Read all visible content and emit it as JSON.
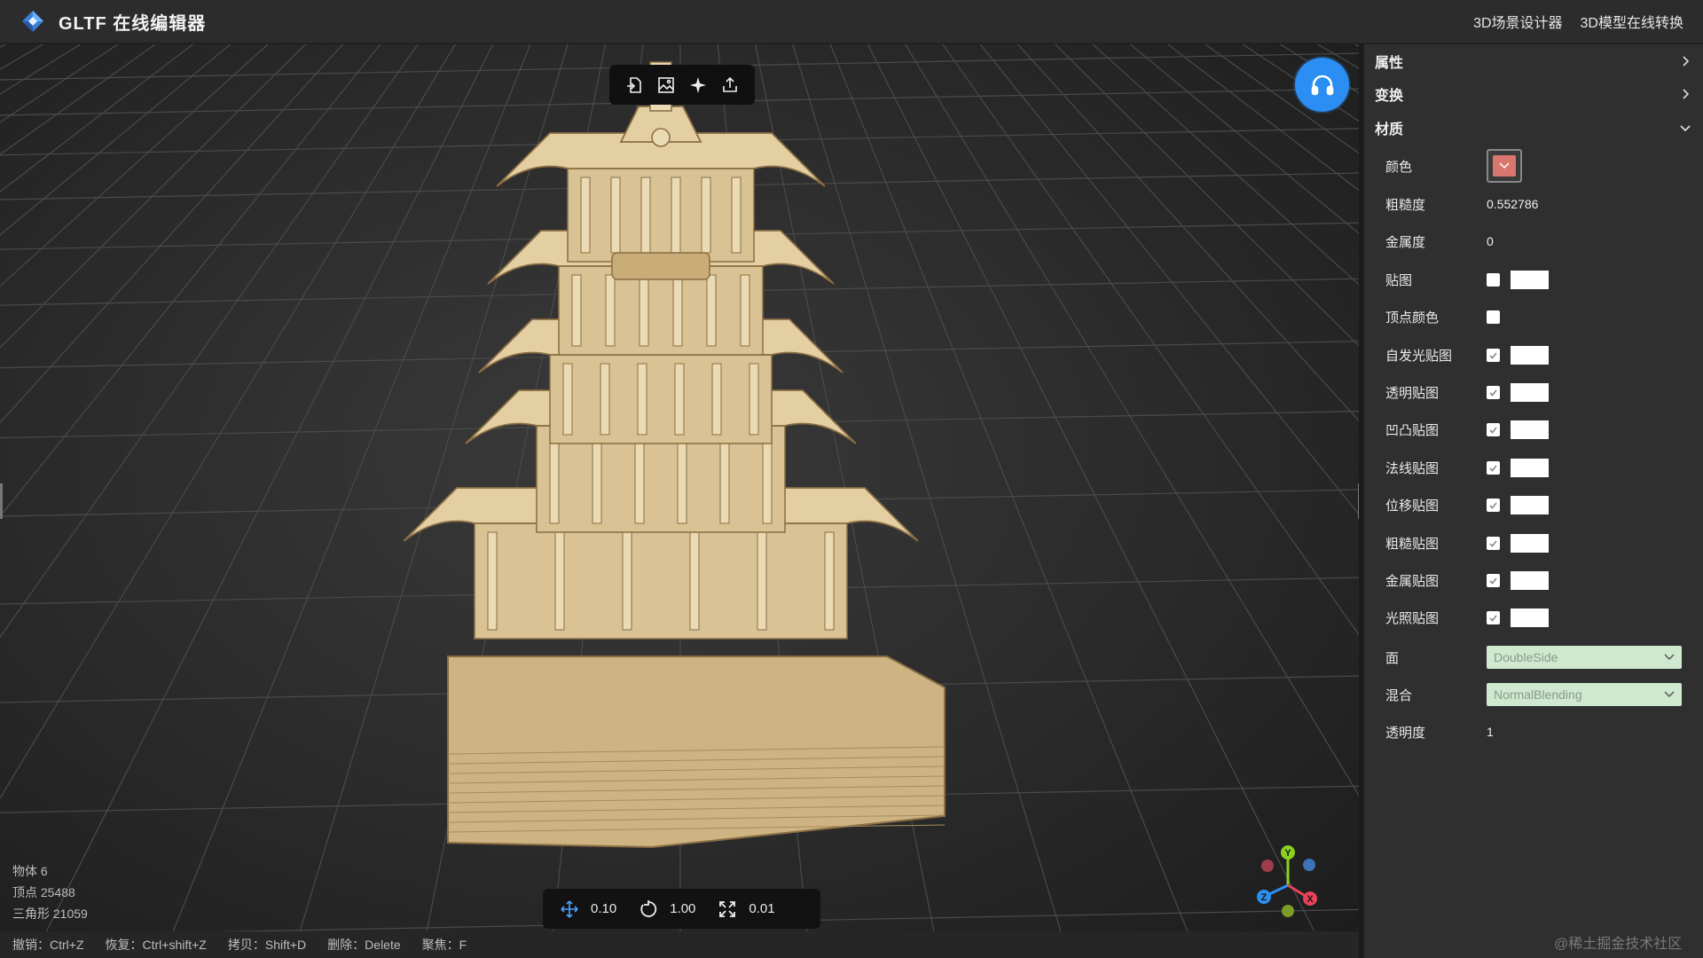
{
  "header": {
    "title": "GLTF 在线编辑器",
    "nav": [
      "3D场景设计器",
      "3D模型在线转换"
    ]
  },
  "toolbar": {
    "icons": [
      "import-icon",
      "image-import-icon",
      "light-icon",
      "export-icon"
    ]
  },
  "stats": {
    "objects": "物体 6",
    "vertices": "顶点 25488",
    "triangles": "三角形 21059"
  },
  "transform": {
    "move_step": "0.10",
    "rotate_step": "1.00",
    "scale_step": "0.01"
  },
  "shortcuts": [
    "撤销：Ctrl+Z",
    "恢复：Ctrl+shift+Z",
    "拷贝：Shift+D",
    "删除：Delete",
    "聚焦：F"
  ],
  "panel": {
    "sections": {
      "properties": "属性",
      "transform": "变换",
      "material": "材质"
    },
    "material": {
      "color_label": "颜色",
      "color_value": "#d9776e",
      "roughness_label": "粗糙度",
      "roughness_value": "0.552786",
      "metalness_label": "金属度",
      "metalness_value": "0",
      "map_label": "贴图",
      "vertex_colors_label": "顶点颜色",
      "textures": [
        {
          "label": "自发光贴图",
          "checked": true
        },
        {
          "label": "透明贴图",
          "checked": true
        },
        {
          "label": "凹凸贴图",
          "checked": true
        },
        {
          "label": "法线贴图",
          "checked": true
        },
        {
          "label": "位移贴图",
          "checked": true
        },
        {
          "label": "粗糙贴图",
          "checked": true
        },
        {
          "label": "金属贴图",
          "checked": true
        },
        {
          "label": "光照贴图",
          "checked": true
        }
      ],
      "side_label": "面",
      "side_value": "DoubleSide",
      "blending_label": "混合",
      "blending_value": "NormalBlending",
      "opacity_label": "透明度",
      "opacity_value": "1"
    }
  },
  "gizmo": {
    "x": "X",
    "y": "Y",
    "z": "Z"
  },
  "watermark": "@稀土掘金技术社区",
  "colors": {
    "accent": "#2a8ef2",
    "panel_bg": "#2f2f2f",
    "select_bg": "#cfe9cf"
  }
}
